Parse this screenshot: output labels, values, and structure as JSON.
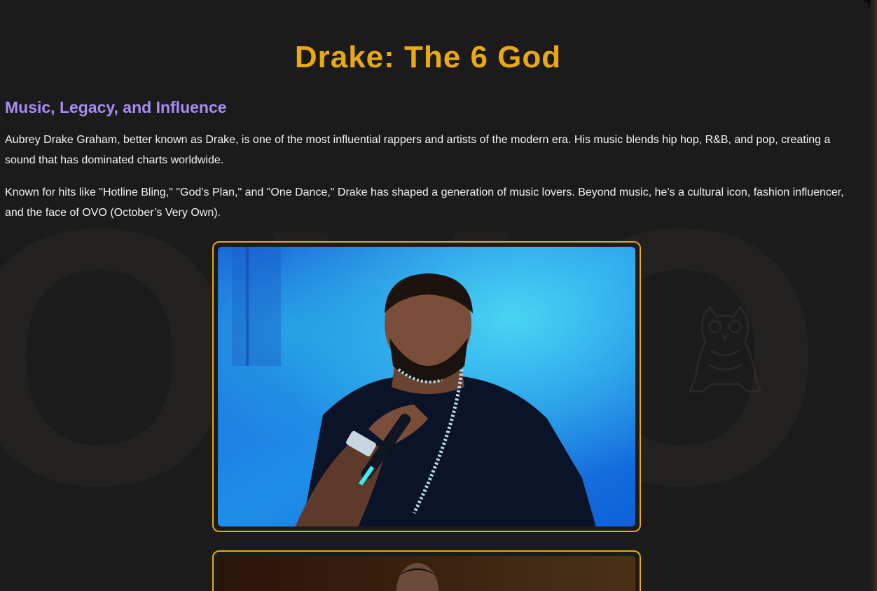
{
  "page": {
    "title": "Drake: The 6 God",
    "subtitle": "Music, Legacy, and Influence",
    "paragraphs": [
      "Aubrey Drake Graham, better known as Drake, is one of the most influential rappers and artists of the modern era. His music blends hip hop, R&B, and pop, creating a sound that has dominated charts worldwide.",
      "Known for hits like \"Hotline Bling,\" \"God’s Plan,\" and \"One Dance,\" Drake has shaped a generation of music lovers. Beyond music, he’s a cultural icon, fashion influencer, and the face of OVO (October’s Very Own)."
    ]
  },
  "background": {
    "watermark_text": "OVO",
    "watermark_icon": "owl-icon"
  },
  "gallery": {
    "images": [
      {
        "icon": "drake-performing-photo"
      },
      {
        "icon": "drake-stage-photo"
      }
    ]
  },
  "colors": {
    "accent": "#e8a912",
    "subtitle": "#a98bf2",
    "background": "#1b1b1b",
    "text": "#f2f2f2"
  }
}
